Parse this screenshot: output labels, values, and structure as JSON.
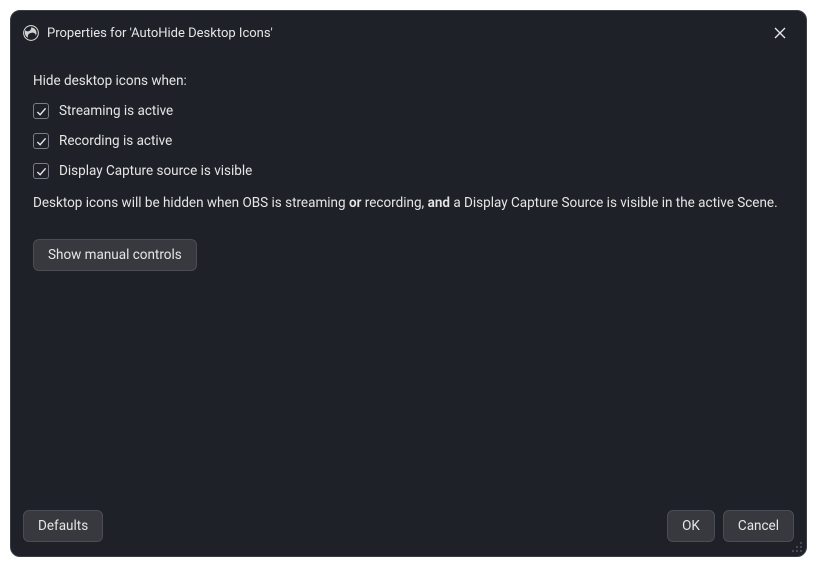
{
  "window": {
    "title": "Properties for 'AutoHide Desktop Icons'"
  },
  "section": {
    "label": "Hide desktop icons when:"
  },
  "checkboxes": [
    {
      "label": "Streaming is active",
      "checked": true
    },
    {
      "label": "Recording is active",
      "checked": true
    },
    {
      "label": "Display Capture source is visible",
      "checked": true
    }
  ],
  "info": {
    "prefix": "Desktop icons will be hidden when OBS is streaming ",
    "bold1": "or",
    "mid": " recording, ",
    "bold2": "and",
    "suffix": " a Display Capture Source is visible in the active Scene."
  },
  "buttons": {
    "manual": "Show manual controls",
    "defaults": "Defaults",
    "ok": "OK",
    "cancel": "Cancel"
  }
}
